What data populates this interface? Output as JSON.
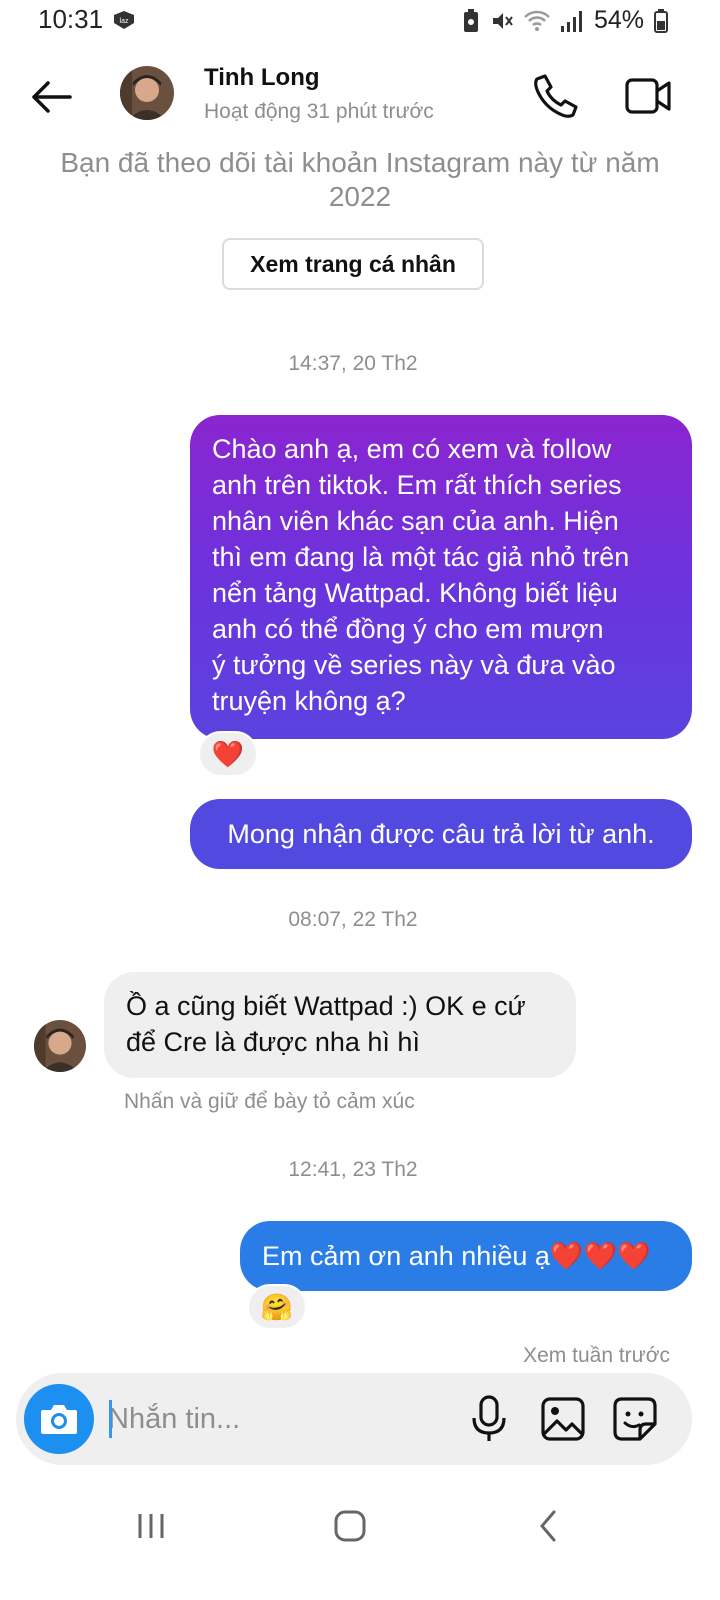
{
  "status_bar": {
    "time": "10:31",
    "app_icon_text": "laz",
    "battery": "54%"
  },
  "header": {
    "contact_name": "Tinh Long",
    "activity": "Hoạt động 31 phút trước"
  },
  "profile_note": {
    "line1": "Bạn đã theo dõi tài khoản Instagram này từ năm",
    "line2": "2022",
    "button_label": "Xem trang cá nhân"
  },
  "conversation": {
    "timestamp_1": "14:37, 20 Th2",
    "msg1_lines": [
      "Chào anh ạ, em có xem và follow",
      "anh trên tiktok. Em rất thích series",
      "nhân viên khác sạn của anh. Hiện",
      "thì em đang là một tác giả nhỏ trên",
      "nển tảng Wattpad. Không biết liệu",
      "anh có thể đồng ý cho em mượn",
      "ý tưởng về series này và đưa vào",
      "truyện không ạ?"
    ],
    "msg1_reaction": "❤️",
    "msg2": "Mong nhận được câu trả lời từ anh.",
    "timestamp_2": "08:07, 22 Th2",
    "reply_lines": [
      "Ồ a cũng biết Wattpad :) OK e cứ",
      "để Cre là được nha hì hì"
    ],
    "react_hint": "Nhấn và giữ để bày tỏ cảm xúc",
    "timestamp_3": "12:41, 23 Th2",
    "msg3": "Em cảm ơn anh nhiều ạ❤️❤️❤️",
    "msg3_reaction": "🤗",
    "see_previous": "Xem tuần trước"
  },
  "composer": {
    "placeholder": "Nhắn tin..."
  },
  "colors": {
    "gradient_top": "#8a25d0",
    "gradient_bottom": "#5a43df",
    "msg2_bg": "#5249e0",
    "msg3_bg": "#2a7de6",
    "camera_btn": "#1d8ff0",
    "incoming_bg": "#efefef",
    "muted_text": "#8e8e8e"
  },
  "icons": {
    "back": "arrow-left-icon",
    "call": "phone-icon",
    "video": "video-camera-icon",
    "camera": "camera-icon",
    "mic": "microphone-icon",
    "gallery": "image-icon",
    "sticker": "sticker-icon"
  }
}
